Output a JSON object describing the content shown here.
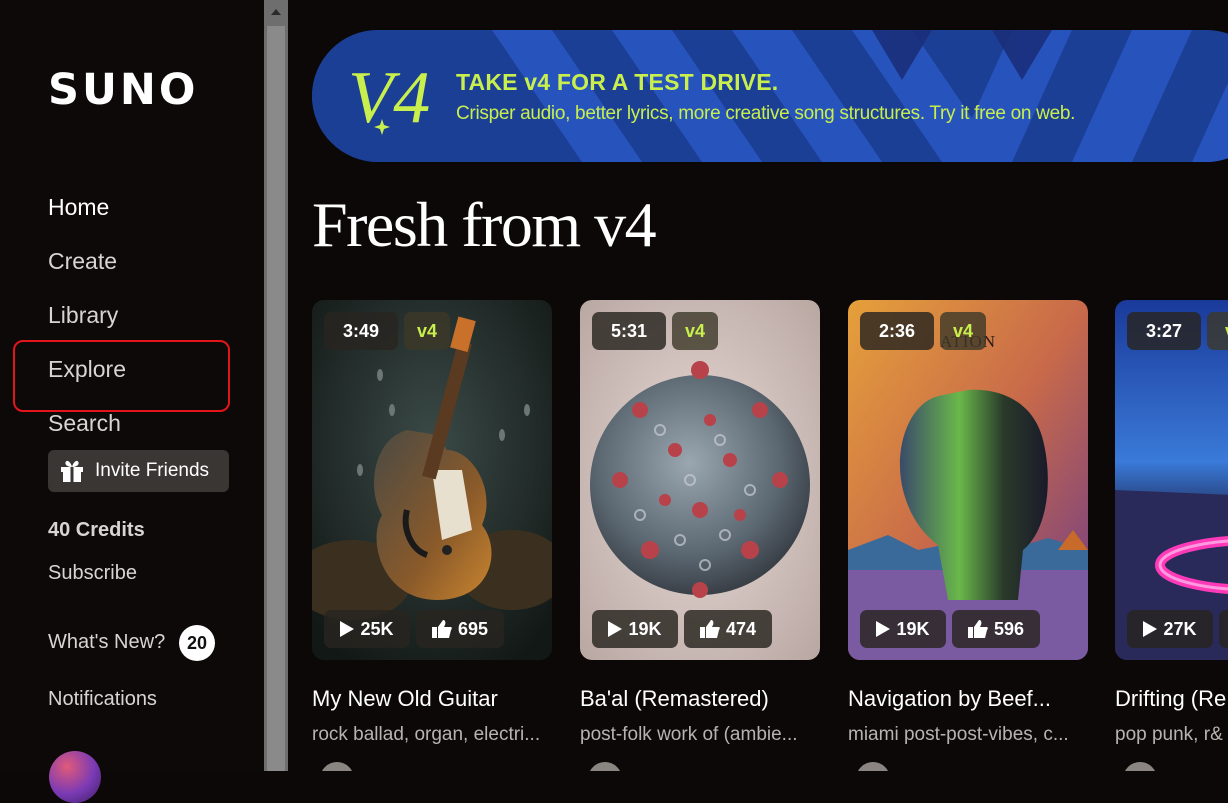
{
  "brand": {
    "logo_text": "SUNO"
  },
  "sidebar": {
    "nav": [
      {
        "label": "Home"
      },
      {
        "label": "Create"
      },
      {
        "label": "Library"
      },
      {
        "label": "Explore"
      },
      {
        "label": "Search"
      }
    ],
    "invite_label": "Invite Friends",
    "credits_label": "40 Credits",
    "subscribe_label": "Subscribe",
    "whats_new_label": "What's New?",
    "whats_new_count": "20",
    "notifications_label": "Notifications"
  },
  "banner": {
    "logo_text": "V4",
    "title": "TAKE v4 FOR A TEST DRIVE.",
    "subtitle": "Crisper audio, better lyrics, more creative song structures. Try it free on web.",
    "accent_color": "#c8ef4d",
    "background_color": "#1b3f95"
  },
  "section": {
    "title": "Fresh from v4"
  },
  "cards": [
    {
      "duration": "3:49",
      "version": "v4",
      "plays": "25K",
      "likes": "695",
      "title": "My New Old Guitar",
      "tags": "rock ballad, organ, electri..."
    },
    {
      "duration": "5:31",
      "version": "v4",
      "plays": "19K",
      "likes": "474",
      "title": "Ba'al (Remastered)",
      "tags": "post-folk work of (ambie..."
    },
    {
      "duration": "2:36",
      "version": "v4",
      "plays": "19K",
      "likes": "596",
      "title": "Navigation by Beef...",
      "tags": "miami post-post-vibes, c...",
      "art_text": "ATION"
    },
    {
      "duration": "3:27",
      "version": "v",
      "plays": "27K",
      "likes": "",
      "title": "Drifting (Re",
      "tags": "pop punk, r&"
    }
  ],
  "icons": [
    "gift-icon",
    "play-icon",
    "thumbs-up-icon",
    "sparkle-icon"
  ],
  "colors": {
    "annotation_red": "#e2151b"
  }
}
